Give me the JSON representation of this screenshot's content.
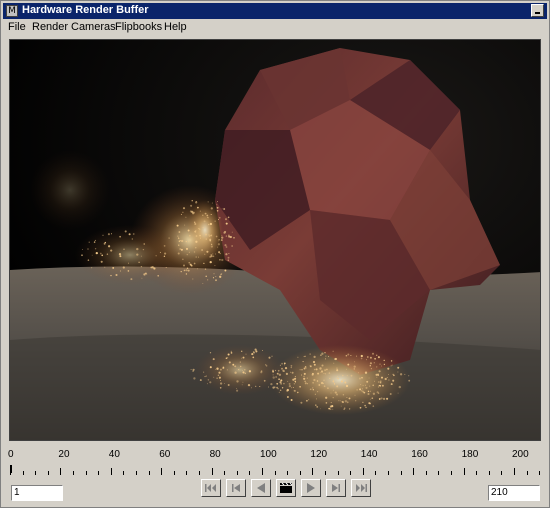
{
  "window": {
    "title": "Hardware Render Buffer",
    "icon_glyph": "M"
  },
  "menubar": {
    "items": [
      "File",
      "Render",
      "Cameras",
      "Flipbooks",
      "Help"
    ]
  },
  "timeline": {
    "tick_labels": [
      "0",
      "20",
      "40",
      "60",
      "80",
      "100",
      "120",
      "140",
      "160",
      "180",
      "200"
    ],
    "start_frame": "1",
    "end_frame": "210",
    "current_frame": 1
  },
  "playback": {
    "buttons": [
      "go-to-start",
      "step-back",
      "play-backward",
      "clapboard",
      "play-forward",
      "step-forward",
      "go-to-end"
    ]
  },
  "colors": {
    "titlebar": "#0a246a",
    "window_bg": "#d4d0c8",
    "viewport_bg": "#000000"
  }
}
